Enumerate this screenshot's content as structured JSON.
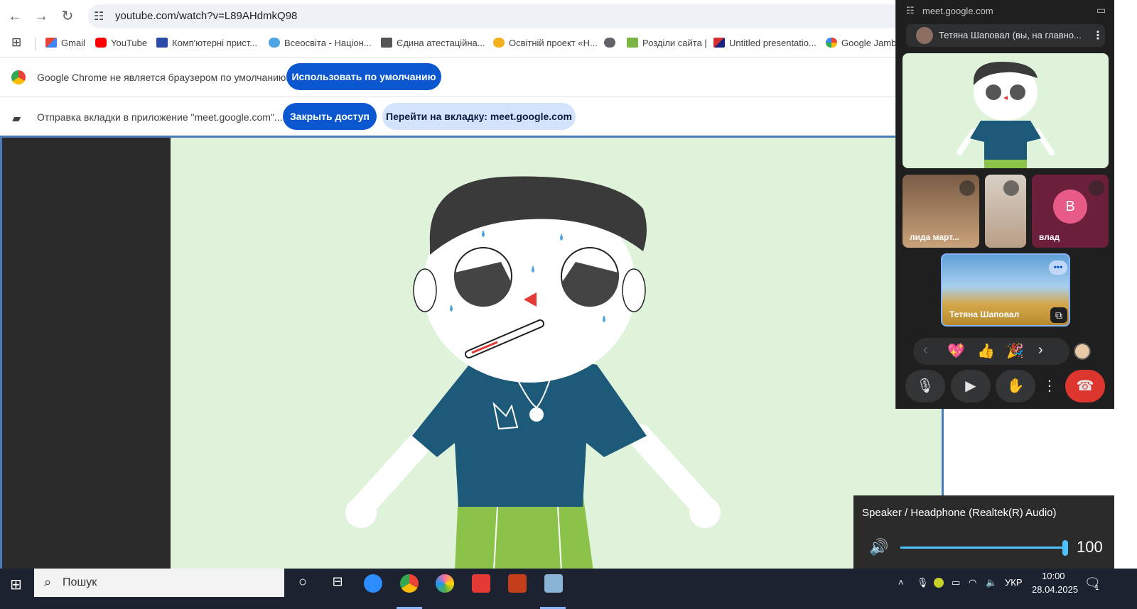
{
  "browser": {
    "url": "youtube.com/watch?v=L89AHdmkQ98",
    "bookmarks": [
      "Gmail",
      "YouTube",
      "Комп'ютерні прист...",
      "Всеосвіта - Націон...",
      "Єдина атестаційна...",
      "Освітній проект «Н...",
      "Розділи сайта |",
      "Untitled presentatio...",
      "Google Jamboard"
    ],
    "infobar_default_text": "Google Chrome не является браузером по умолчанию.",
    "infobar_default_button": "Использовать по умолчанию",
    "infobar_share_text": "Отправка вкладки в приложение \"meet.google.com\"...",
    "infobar_share_stop": "Закрыть доступ",
    "infobar_share_switch": "Перейти на вкладку: meet.google.com"
  },
  "meet": {
    "site": "meet.google.com",
    "presenter_label": "Тетяна Шаповал (вы, на главно...",
    "participants": [
      {
        "name": "лида март...",
        "muted": true
      },
      {
        "name": "",
        "muted": true
      },
      {
        "name": "влад",
        "initial": "В",
        "muted": true
      },
      {
        "name": "Тетяна Шаповал",
        "muted": false
      }
    ],
    "reactions": [
      "💖",
      "👍",
      "🎉"
    ],
    "colors": {
      "accent": "#0b57d0",
      "end_call": "#dc362e",
      "avatar_v": "#e85a87"
    }
  },
  "volume": {
    "device": "Speaker / Headphone (Realtek(R) Audio)",
    "level": 100,
    "level_text": "100"
  },
  "taskbar": {
    "search_placeholder": "Пошук",
    "language": "УКР",
    "time": "10:00",
    "date": "28.04.2025",
    "notifications": "1"
  }
}
